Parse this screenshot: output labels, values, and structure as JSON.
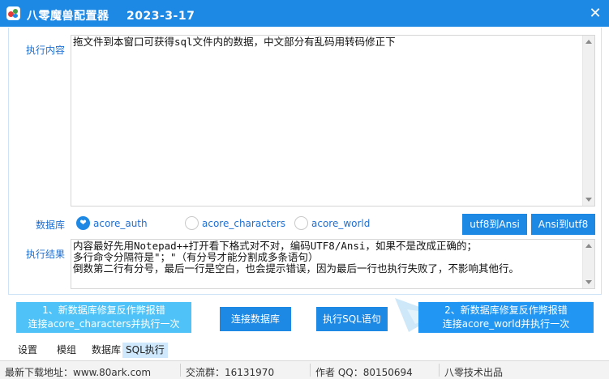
{
  "window": {
    "title": "八零魔兽配置器    2023-3-17",
    "close_symbol": "✕",
    "colors": {
      "titlebar": "#1e88e5",
      "accent": "#1e88e5",
      "accent_light": "#4fc3f7"
    }
  },
  "exec_content": {
    "label": "执行内容",
    "value": "拖文件到本窗口可获得sql文件内的数据，中文部分有乱码用转码修正下"
  },
  "database": {
    "label": "数据库",
    "options": [
      {
        "label": "acore_auth",
        "selected": true
      },
      {
        "label": "acore_characters",
        "selected": false
      },
      {
        "label": "acore_world",
        "selected": false
      }
    ],
    "selected_mark": "❤",
    "utf8_to_ansi": "utf8到Ansi",
    "ansi_to_utf8": "Ansi到utf8"
  },
  "exec_result": {
    "label": "执行结果",
    "lines": [
      "内容最好先用Notepad++打开看下格式对不对，编码UTF8/Ansi，如果不是改成正确的；",
      "多行命令分隔符是\"；\"（有分号才能分割成多条语句）",
      "倒数第二行有分号，最后一行是空白，也会提示错误，因为最后一行也执行失败了，不影响其他行。"
    ]
  },
  "actions": {
    "fix_characters": {
      "line1": "1、新数据库修复反作弊报错",
      "line2": "连接acore_characters并执行一次"
    },
    "connect_db": "连接数据库",
    "exec_sql": "执行SQL语句",
    "fix_world": {
      "line1": "2、新数据库修复反作弊报错",
      "line2": "连接acore_world并执行一次"
    }
  },
  "tabs": [
    {
      "label": "设置",
      "active": false
    },
    {
      "label": "模组",
      "active": false
    },
    {
      "label": "数据库",
      "active": false
    },
    {
      "label": "SQL执行",
      "active": true
    }
  ],
  "statusbar": {
    "download": "最新下载地址：www.80ark.com",
    "group": "交流群：16131970",
    "author": "作者 QQ：80150694",
    "product": "八零技术出品"
  }
}
